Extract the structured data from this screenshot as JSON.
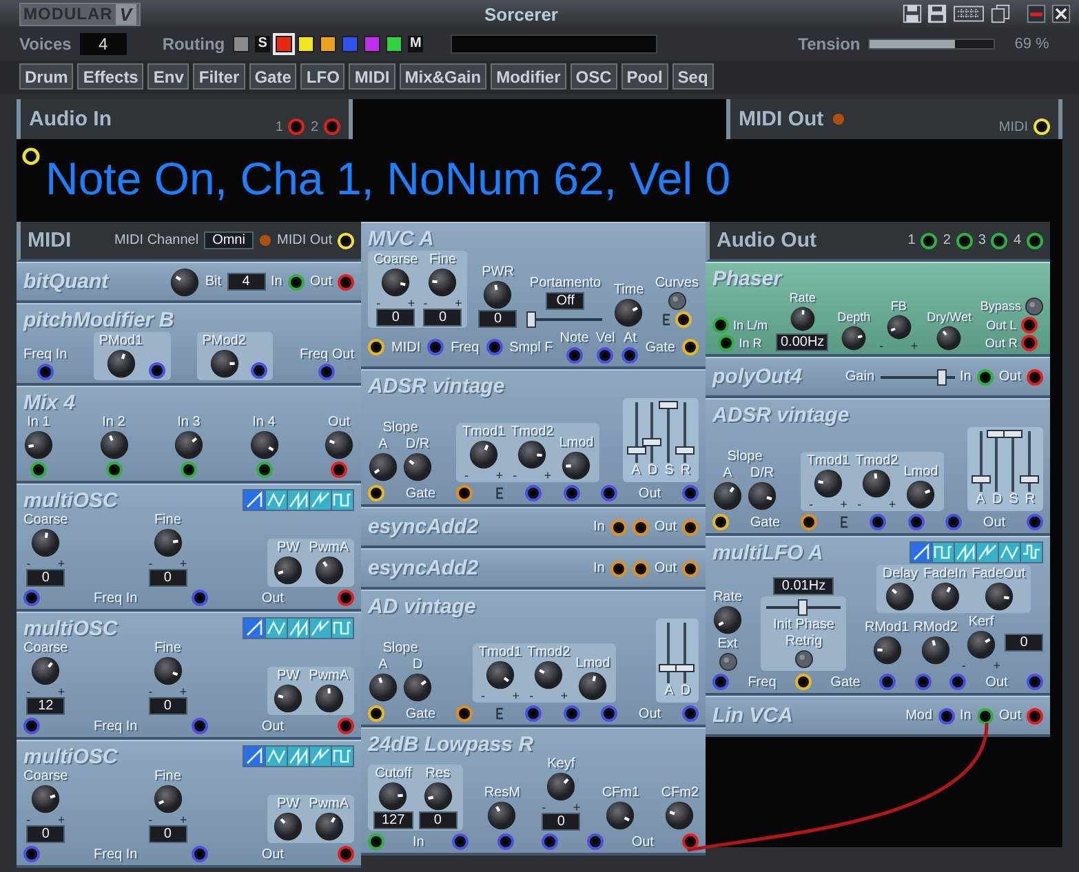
{
  "window": {
    "logo": "MODULAR",
    "logo_mark": "V",
    "title": "Sorcerer"
  },
  "toolbar": {
    "voices_label": "Voices",
    "voices": "4",
    "routing_label": "Routing",
    "routing": [
      {
        "kind": "swatch",
        "color": "#8c8c8c",
        "selected": false
      },
      {
        "kind": "letter",
        "label": "S",
        "selected": false
      },
      {
        "kind": "swatch",
        "color": "#e42a12",
        "selected": true
      },
      {
        "kind": "swatch",
        "color": "#f2e61c",
        "selected": false
      },
      {
        "kind": "swatch",
        "color": "#f0a020",
        "selected": false
      },
      {
        "kind": "swatch",
        "color": "#3050f0",
        "selected": false
      },
      {
        "kind": "swatch",
        "color": "#c030e8",
        "selected": false
      },
      {
        "kind": "swatch",
        "color": "#30d040",
        "selected": false
      },
      {
        "kind": "letter",
        "label": "M",
        "selected": false
      }
    ],
    "tension_label": "Tension",
    "tension": {
      "level": 0.69,
      "reading": "69 %"
    }
  },
  "categories": [
    "Drum",
    "Effects",
    "Env",
    "Filter",
    "Gate",
    "LFO",
    "MIDI",
    "Mix&Gain",
    "Modifier",
    "OSC",
    "Pool",
    "Seq"
  ],
  "rack": {
    "audio_in": {
      "title": "Audio In",
      "ports": [
        {
          "label": "1",
          "color": "#e02020"
        },
        {
          "label": "2",
          "color": "#e02020"
        }
      ]
    },
    "midi_out": {
      "title": "MIDI Out",
      "ports": [
        {
          "label": "MIDI",
          "color": "#f0e040"
        }
      ]
    },
    "display": "Note On, Cha 1, NoNum 62, Vel 0",
    "columns": [
      {
        "modules": [
          {
            "title": "MIDI",
            "kind": "header",
            "controls": [
              {
                "kind": "label",
                "text": "MIDI Channel"
              },
              {
                "kind": "box",
                "value": "Omni"
              },
              {
                "kind": "led"
              },
              {
                "kind": "label",
                "text": "MIDI Out"
              },
              {
                "kind": "jack",
                "color": "#f0e040"
              }
            ]
          },
          {
            "title": "bitQuant",
            "kind": "strip",
            "controls": [
              {
                "kind": "knob"
              },
              {
                "kind": "label",
                "text": "Bit"
              },
              {
                "kind": "box",
                "value": "4"
              },
              {
                "kind": "label",
                "text": "In"
              },
              {
                "kind": "jack",
                "color": "#30b040"
              },
              {
                "kind": "label",
                "text": "Out"
              },
              {
                "kind": "jack",
                "color": "#e02020"
              }
            ]
          },
          {
            "title": "pitchModifier B",
            "kind": "panel",
            "controls": [
              {
                "kind": "stack",
                "items": [
                  {
                    "kind": "label",
                    "text": "Freq In"
                  },
                  {
                    "kind": "jack",
                    "color": "#4a50e0"
                  }
                ]
              },
              {
                "kind": "group",
                "items": [
                  {
                    "kind": "knob",
                    "label": "PMod1"
                  },
                  {
                    "kind": "jack",
                    "color": "#4a50e0"
                  }
                ]
              },
              {
                "kind": "group",
                "items": [
                  {
                    "kind": "knob",
                    "label": "PMod2"
                  },
                  {
                    "kind": "jack",
                    "color": "#4a50e0"
                  }
                ]
              },
              {
                "kind": "stack",
                "items": [
                  {
                    "kind": "label",
                    "text": "Freq Out"
                  },
                  {
                    "kind": "jack",
                    "color": "#4a50e0"
                  }
                ]
              }
            ]
          },
          {
            "title": "Mix 4",
            "kind": "panel",
            "controls": [
              {
                "kind": "stack",
                "items": [
                  {
                    "kind": "knob",
                    "label": "In 1"
                  },
                  {
                    "kind": "jack",
                    "color": "#30b040"
                  }
                ]
              },
              {
                "kind": "stack",
                "items": [
                  {
                    "kind": "knob",
                    "label": "In 2"
                  },
                  {
                    "kind": "jack",
                    "color": "#30b040"
                  }
                ]
              },
              {
                "kind": "stack",
                "items": [
                  {
                    "kind": "knob",
                    "label": "In 3"
                  },
                  {
                    "kind": "jack",
                    "color": "#30b040"
                  }
                ]
              },
              {
                "kind": "stack",
                "items": [
                  {
                    "kind": "knob",
                    "label": "In 4"
                  },
                  {
                    "kind": "jack",
                    "color": "#30b040"
                  }
                ]
              },
              {
                "kind": "stack",
                "items": [
                  {
                    "kind": "knob",
                    "label": "Out"
                  },
                  {
                    "kind": "jack",
                    "color": "#e02020"
                  }
                ]
              }
            ]
          },
          {
            "title": "multiOSC",
            "kind": "panel",
            "header": [
              {
                "kind": "waves",
                "shapes": [
                  {
                    "kind": "saw",
                    "selected": true
                  },
                  {
                    "kind": "triangle",
                    "selected": false
                  },
                  {
                    "kind": "ramp",
                    "selected": false
                  },
                  {
                    "kind": "step",
                    "selected": false
                  },
                  {
                    "kind": "square",
                    "selected": false
                  }
                ]
              }
            ],
            "controls": [
              {
                "kind": "knob",
                "label": "Coarse",
                "value": "0",
                "minus": "-",
                "plus": "+"
              },
              {
                "kind": "knob",
                "label": "Fine",
                "value": "0",
                "minus": "-",
                "plus": "+"
              },
              {
                "kind": "group",
                "items": [
                  {
                    "kind": "knob",
                    "label": "PW"
                  },
                  {
                    "kind": "knob",
                    "label": "PwmA"
                  }
                ]
              }
            ],
            "jacks": [
              {
                "kind": "jack",
                "color": "#4a50e0"
              },
              {
                "kind": "label",
                "text": "Freq In"
              },
              {
                "kind": "jack",
                "color": "#4a50e0"
              },
              {
                "kind": "label",
                "text": "Out"
              },
              {
                "kind": "jack",
                "color": "#e02020"
              }
            ]
          },
          {
            "title": "multiOSC",
            "kind": "panel",
            "header": [
              {
                "kind": "waves",
                "shapes": [
                  {
                    "kind": "saw",
                    "selected": true
                  },
                  {
                    "kind": "triangle",
                    "selected": false
                  },
                  {
                    "kind": "ramp",
                    "selected": false
                  },
                  {
                    "kind": "step",
                    "selected": false
                  },
                  {
                    "kind": "square",
                    "selected": false
                  }
                ]
              }
            ],
            "controls": [
              {
                "kind": "knob",
                "label": "Coarse",
                "value": "12",
                "minus": "-",
                "plus": "+"
              },
              {
                "kind": "knob",
                "label": "Fine",
                "value": "0",
                "minus": "-",
                "plus": "+"
              },
              {
                "kind": "group",
                "items": [
                  {
                    "kind": "knob",
                    "label": "PW"
                  },
                  {
                    "kind": "knob",
                    "label": "PwmA"
                  }
                ]
              }
            ],
            "jacks": [
              {
                "kind": "jack",
                "color": "#4a50e0"
              },
              {
                "kind": "label",
                "text": "Freq In"
              },
              {
                "kind": "jack",
                "color": "#4a50e0"
              },
              {
                "kind": "label",
                "text": "Out"
              },
              {
                "kind": "jack",
                "color": "#e02020"
              }
            ]
          },
          {
            "title": "multiOSC",
            "kind": "panel",
            "header": [
              {
                "kind": "waves",
                "shapes": [
                  {
                    "kind": "saw",
                    "selected": true
                  },
                  {
                    "kind": "triangle",
                    "selected": false
                  },
                  {
                    "kind": "ramp",
                    "selected": false
                  },
                  {
                    "kind": "step",
                    "selected": false
                  },
                  {
                    "kind": "square",
                    "selected": false
                  }
                ]
              }
            ],
            "controls": [
              {
                "kind": "knob",
                "label": "Coarse",
                "value": "0",
                "minus": "-",
                "plus": "+"
              },
              {
                "kind": "knob",
                "label": "Fine",
                "value": "0",
                "minus": "-",
                "plus": "+"
              },
              {
                "kind": "group",
                "items": [
                  {
                    "kind": "knob",
                    "label": "PW"
                  },
                  {
                    "kind": "knob",
                    "label": "PwmA"
                  }
                ]
              }
            ],
            "jacks": [
              {
                "kind": "jack",
                "color": "#4a50e0"
              },
              {
                "kind": "label",
                "text": "Freq In"
              },
              {
                "kind": "jack",
                "color": "#4a50e0"
              },
              {
                "kind": "label",
                "text": "Out"
              },
              {
                "kind": "jack",
                "color": "#e02020"
              }
            ]
          }
        ]
      },
      {
        "modules": [
          {
            "title": "MVC A",
            "kind": "panel",
            "controls": [
              {
                "kind": "group",
                "items": [
                  {
                    "kind": "knob",
                    "label": "Coarse",
                    "value": "0",
                    "minus": "-",
                    "plus": "+"
                  },
                  {
                    "kind": "knob",
                    "label": "Fine",
                    "value": "0",
                    "minus": "-",
                    "plus": "+"
                  }
                ]
              },
              {
                "kind": "knob",
                "label": "PWR",
                "value": "0"
              },
              {
                "kind": "stack",
                "items": [
                  {
                    "kind": "label",
                    "text": "Portamento"
                  },
                  {
                    "kind": "box",
                    "value": "Off"
                  },
                  {
                    "kind": "slider",
                    "level": 0.05
                  }
                ]
              },
              {
                "kind": "knob",
                "label": "Time"
              },
              {
                "kind": "stack",
                "items": [
                  {
                    "kind": "label",
                    "text": "Curves"
                  },
                  {
                    "kind": "button"
                  },
                  {
                    "kind": "row",
                    "items": [
                      {
                        "kind": "icon"
                      },
                      {
                        "kind": "jack",
                        "color": "#e8b820"
                      }
                    ]
                  }
                ]
              }
            ],
            "jacks": [
              {
                "kind": "jack",
                "color": "#e8b820"
              },
              {
                "kind": "label",
                "text": "MIDI"
              },
              {
                "kind": "jack",
                "color": "#4a50e0"
              },
              {
                "kind": "label",
                "text": "Freq"
              },
              {
                "kind": "jack",
                "color": "#4a50e0"
              },
              {
                "kind": "label",
                "text": "Smpl F"
              },
              {
                "kind": "stack",
                "items": [
                  {
                    "kind": "label",
                    "text": "Note"
                  },
                  {
                    "kind": "jack",
                    "color": "#4a50e0"
                  }
                ]
              },
              {
                "kind": "stack",
                "items": [
                  {
                    "kind": "label",
                    "text": "Vel"
                  },
                  {
                    "kind": "jack",
                    "color": "#4a50e0"
                  }
                ]
              },
              {
                "kind": "stack",
                "items": [
                  {
                    "kind": "label",
                    "text": "At"
                  },
                  {
                    "kind": "jack",
                    "color": "#4a50e0"
                  }
                ]
              },
              {
                "kind": "label",
                "text": "Gate"
              },
              {
                "kind": "jack",
                "color": "#e8b820"
              }
            ]
          },
          {
            "title": "ADSR vintage",
            "kind": "panel",
            "controls": [
              {
                "kind": "stack",
                "items": [
                  {
                    "kind": "label",
                    "text": "Slope"
                  },
                  {
                    "kind": "row",
                    "items": [
                      {
                        "kind": "knob",
                        "label": "A"
                      },
                      {
                        "kind": "knob",
                        "label": "D/R"
                      }
                    ]
                  }
                ]
              },
              {
                "kind": "group",
                "items": [
                  {
                    "kind": "knob",
                    "label": "Tmod1",
                    "minus": "-",
                    "plus": "+"
                  },
                  {
                    "kind": "knob",
                    "label": "Tmod2",
                    "minus": "-",
                    "plus": "+"
                  },
                  {
                    "kind": "knob",
                    "label": "Lmod"
                  }
                ]
              },
              {
                "kind": "faders",
                "items": [
                  {
                    "label": "A",
                    "level": 0.2
                  },
                  {
                    "label": "D",
                    "level": 0.35
                  },
                  {
                    "label": "S",
                    "level": 0.95
                  },
                  {
                    "label": "R",
                    "level": 0.2
                  }
                ]
              }
            ],
            "jacks": [
              {
                "kind": "jack",
                "color": "#e8b820"
              },
              {
                "kind": "label",
                "text": "Gate"
              },
              {
                "kind": "jack",
                "color": "#e09020"
              },
              {
                "kind": "icon"
              },
              {
                "kind": "jack",
                "color": "#4a50e0"
              },
              {
                "kind": "jack",
                "color": "#4a50e0"
              },
              {
                "kind": "jack",
                "color": "#4a50e0"
              },
              {
                "kind": "label",
                "text": "Out"
              },
              {
                "kind": "jack",
                "color": "#4a50e0"
              }
            ]
          },
          {
            "title": "esyncAdd2",
            "kind": "strip",
            "controls": [
              {
                "kind": "label",
                "text": "In"
              },
              {
                "kind": "jack",
                "color": "#e09020"
              },
              {
                "kind": "jack",
                "color": "#e09020"
              },
              {
                "kind": "label",
                "text": "Out"
              },
              {
                "kind": "jack",
                "color": "#e09020"
              }
            ]
          },
          {
            "title": "esyncAdd2",
            "kind": "strip",
            "controls": [
              {
                "kind": "label",
                "text": "In"
              },
              {
                "kind": "jack",
                "color": "#e09020"
              },
              {
                "kind": "jack",
                "color": "#e09020"
              },
              {
                "kind": "label",
                "text": "Out"
              },
              {
                "kind": "jack",
                "color": "#e09020"
              }
            ]
          },
          {
            "title": "AD vintage",
            "kind": "panel",
            "controls": [
              {
                "kind": "stack",
                "items": [
                  {
                    "kind": "label",
                    "text": "Slope"
                  },
                  {
                    "kind": "row",
                    "items": [
                      {
                        "kind": "knob",
                        "label": "A"
                      },
                      {
                        "kind": "knob",
                        "label": "D"
                      }
                    ]
                  }
                ]
              },
              {
                "kind": "group",
                "items": [
                  {
                    "kind": "knob",
                    "label": "Tmod1",
                    "minus": "-",
                    "plus": "+"
                  },
                  {
                    "kind": "knob",
                    "label": "Tmod2",
                    "minus": "-",
                    "plus": "+"
                  },
                  {
                    "kind": "knob",
                    "label": "Lmod"
                  }
                ]
              },
              {
                "kind": "faders",
                "items": [
                  {
                    "label": "A",
                    "level": 0.25
                  },
                  {
                    "label": "D",
                    "level": 0.25
                  }
                ]
              }
            ],
            "jacks": [
              {
                "kind": "jack",
                "color": "#e8b820"
              },
              {
                "kind": "label",
                "text": "Gate"
              },
              {
                "kind": "jack",
                "color": "#e09020"
              },
              {
                "kind": "icon"
              },
              {
                "kind": "jack",
                "color": "#4a50e0"
              },
              {
                "kind": "jack",
                "color": "#4a50e0"
              },
              {
                "kind": "jack",
                "color": "#4a50e0"
              },
              {
                "kind": "label",
                "text": "Out"
              },
              {
                "kind": "jack",
                "color": "#4a50e0"
              }
            ]
          },
          {
            "title": "24dB Lowpass R",
            "kind": "panel",
            "controls": [
              {
                "kind": "group",
                "items": [
                  {
                    "kind": "knob",
                    "label": "Cutoff",
                    "value": "127"
                  },
                  {
                    "kind": "knob",
                    "label": "Res",
                    "value": "0"
                  }
                ]
              },
              {
                "kind": "knob",
                "label": "ResM"
              },
              {
                "kind": "knob",
                "label": "Keyf",
                "value": "0",
                "minus": "-",
                "plus": "+"
              },
              {
                "kind": "knob",
                "label": "CFm1"
              },
              {
                "kind": "knob",
                "label": "CFm2"
              }
            ],
            "jacks": [
              {
                "kind": "jack",
                "color": "#30b040"
              },
              {
                "kind": "label",
                "text": "In"
              },
              {
                "kind": "jack",
                "color": "#4a50e0"
              },
              {
                "kind": "jack",
                "color": "#4a50e0"
              },
              {
                "kind": "jack",
                "color": "#4a50e0"
              },
              {
                "kind": "jack",
                "color": "#4a50e0"
              },
              {
                "kind": "label",
                "text": "Out"
              },
              {
                "kind": "jack",
                "color": "#e02020"
              }
            ]
          }
        ]
      },
      {
        "modules": [
          {
            "title": "Audio Out",
            "kind": "header",
            "controls": [
              {
                "kind": "label",
                "text": "1"
              },
              {
                "kind": "jack",
                "color": "#30b040"
              },
              {
                "kind": "label",
                "text": "2"
              },
              {
                "kind": "jack",
                "color": "#30b040"
              },
              {
                "kind": "label",
                "text": "3"
              },
              {
                "kind": "jack",
                "color": "#30b040"
              },
              {
                "kind": "label",
                "text": "4"
              },
              {
                "kind": "jack",
                "color": "#30b040"
              }
            ]
          },
          {
            "title": "Phaser",
            "kind": "effect",
            "controls": [
              {
                "kind": "stack",
                "items": [
                  {
                    "kind": "row",
                    "items": [
                      {
                        "kind": "jack",
                        "color": "#30b040"
                      },
                      {
                        "kind": "label",
                        "text": "In L/m"
                      }
                    ]
                  },
                  {
                    "kind": "row",
                    "items": [
                      {
                        "kind": "jack",
                        "color": "#30b040"
                      },
                      {
                        "kind": "label",
                        "text": "In R"
                      }
                    ]
                  }
                ]
              },
              {
                "kind": "stack",
                "items": [
                  {
                    "kind": "knob",
                    "label": "Rate"
                  },
                  {
                    "kind": "box",
                    "value": "0.00Hz"
                  }
                ]
              },
              {
                "kind": "knob",
                "label": "Depth"
              },
              {
                "kind": "knob",
                "label": "FB",
                "minus": "-",
                "plus": "+"
              },
              {
                "kind": "knob",
                "label": "Dry/Wet"
              },
              {
                "kind": "stack",
                "items": [
                  {
                    "kind": "row",
                    "items": [
                      {
                        "kind": "label",
                        "text": "Bypass"
                      },
                      {
                        "kind": "button"
                      }
                    ]
                  },
                  {
                    "kind": "row",
                    "items": [
                      {
                        "kind": "label",
                        "text": "Out L"
                      },
                      {
                        "kind": "jack",
                        "color": "#e02020"
                      }
                    ]
                  },
                  {
                    "kind": "row",
                    "items": [
                      {
                        "kind": "label",
                        "text": "Out R"
                      },
                      {
                        "kind": "jack",
                        "color": "#e02020"
                      }
                    ]
                  }
                ]
              }
            ]
          },
          {
            "title": "polyOut4",
            "kind": "strip",
            "controls": [
              {
                "kind": "label",
                "text": "Gain"
              },
              {
                "kind": "slider",
                "level": 0.85
              },
              {
                "kind": "label",
                "text": "In"
              },
              {
                "kind": "jack",
                "color": "#30b040"
              },
              {
                "kind": "label",
                "text": "Out"
              },
              {
                "kind": "jack",
                "color": "#e02020"
              }
            ]
          },
          {
            "title": "ADSR vintage",
            "kind": "panel",
            "controls": [
              {
                "kind": "stack",
                "items": [
                  {
                    "kind": "label",
                    "text": "Slope"
                  },
                  {
                    "kind": "row",
                    "items": [
                      {
                        "kind": "knob",
                        "label": "A"
                      },
                      {
                        "kind": "knob",
                        "label": "D/R"
                      }
                    ]
                  }
                ]
              },
              {
                "kind": "group",
                "items": [
                  {
                    "kind": "knob",
                    "label": "Tmod1",
                    "minus": "-",
                    "plus": "+"
                  },
                  {
                    "kind": "knob",
                    "label": "Tmod2",
                    "minus": "-",
                    "plus": "+"
                  },
                  {
                    "kind": "knob",
                    "label": "Lmod"
                  }
                ]
              },
              {
                "kind": "faders",
                "items": [
                  {
                    "label": "A",
                    "level": 0.2
                  },
                  {
                    "label": "D",
                    "level": 0.95
                  },
                  {
                    "label": "S",
                    "level": 0.95
                  },
                  {
                    "label": "R",
                    "level": 0.2
                  }
                ]
              }
            ],
            "jacks": [
              {
                "kind": "jack",
                "color": "#e8b820"
              },
              {
                "kind": "label",
                "text": "Gate"
              },
              {
                "kind": "jack",
                "color": "#e09020"
              },
              {
                "kind": "icon"
              },
              {
                "kind": "jack",
                "color": "#4a50e0"
              },
              {
                "kind": "jack",
                "color": "#4a50e0"
              },
              {
                "kind": "jack",
                "color": "#4a50e0"
              },
              {
                "kind": "label",
                "text": "Out"
              },
              {
                "kind": "jack",
                "color": "#4a50e0"
              }
            ]
          },
          {
            "title": "multiLFO A",
            "kind": "panel",
            "header": [
              {
                "kind": "waves",
                "shapes": [
                  {
                    "kind": "saw",
                    "selected": true
                  },
                  {
                    "kind": "square",
                    "selected": false
                  },
                  {
                    "kind": "ramp",
                    "selected": false
                  },
                  {
                    "kind": "step",
                    "selected": false
                  },
                  {
                    "kind": "triangle",
                    "selected": false
                  },
                  {
                    "kind": "random",
                    "selected": false
                  }
                ]
              }
            ],
            "controls": [
              {
                "kind": "stack",
                "items": [
                  {
                    "kind": "knob",
                    "label": "Rate"
                  },
                  {
                    "kind": "label",
                    "text": "Ext"
                  },
                  {
                    "kind": "button"
                  }
                ]
              },
              {
                "kind": "stack",
                "items": [
                  {
                    "kind": "box",
                    "value": "0.01Hz"
                  },
                  {
                    "kind": "panel",
                    "items": [
                      {
                        "kind": "slider",
                        "level": 0.5
                      },
                      {
                        "kind": "label",
                        "text": "Init Phase"
                      },
                      {
                        "kind": "label",
                        "text": "Retrig"
                      },
                      {
                        "kind": "button"
                      }
                    ]
                  }
                ]
              },
              {
                "kind": "stack",
                "items": [
                  {
                    "kind": "group",
                    "items": [
                      {
                        "kind": "knob",
                        "label": "Delay"
                      },
                      {
                        "kind": "knob",
                        "label": "FadeIn"
                      },
                      {
                        "kind": "knob",
                        "label": "FadeOut"
                      }
                    ]
                  },
                  {
                    "kind": "row",
                    "items": [
                      {
                        "kind": "knob",
                        "label": "RMod1"
                      },
                      {
                        "kind": "knob",
                        "label": "RMod2"
                      },
                      {
                        "kind": "knob",
                        "label": "Kerf",
                        "minus": "-",
                        "plus": "+"
                      },
                      {
                        "kind": "box",
                        "value": "0"
                      }
                    ]
                  }
                ]
              }
            ],
            "jacks": [
              {
                "kind": "jack",
                "color": "#4a50e0"
              },
              {
                "kind": "label",
                "text": "Freq"
              },
              {
                "kind": "jack",
                "color": "#e8b820"
              },
              {
                "kind": "label",
                "text": "Gate"
              },
              {
                "kind": "jack",
                "color": "#4a50e0"
              },
              {
                "kind": "jack",
                "color": "#4a50e0"
              },
              {
                "kind": "jack",
                "color": "#4a50e0"
              },
              {
                "kind": "label",
                "text": "Out"
              },
              {
                "kind": "jack",
                "color": "#4a50e0"
              }
            ]
          },
          {
            "title": "Lin VCA",
            "kind": "strip",
            "controls": [
              {
                "kind": "label",
                "text": "Mod"
              },
              {
                "kind": "jack",
                "color": "#4a50e0"
              },
              {
                "kind": "label",
                "text": "In"
              },
              {
                "kind": "jack",
                "color": "#30b040"
              },
              {
                "kind": "label",
                "text": "Out"
              },
              {
                "kind": "jack",
                "color": "#e02020"
              }
            ]
          }
        ]
      }
    ]
  }
}
